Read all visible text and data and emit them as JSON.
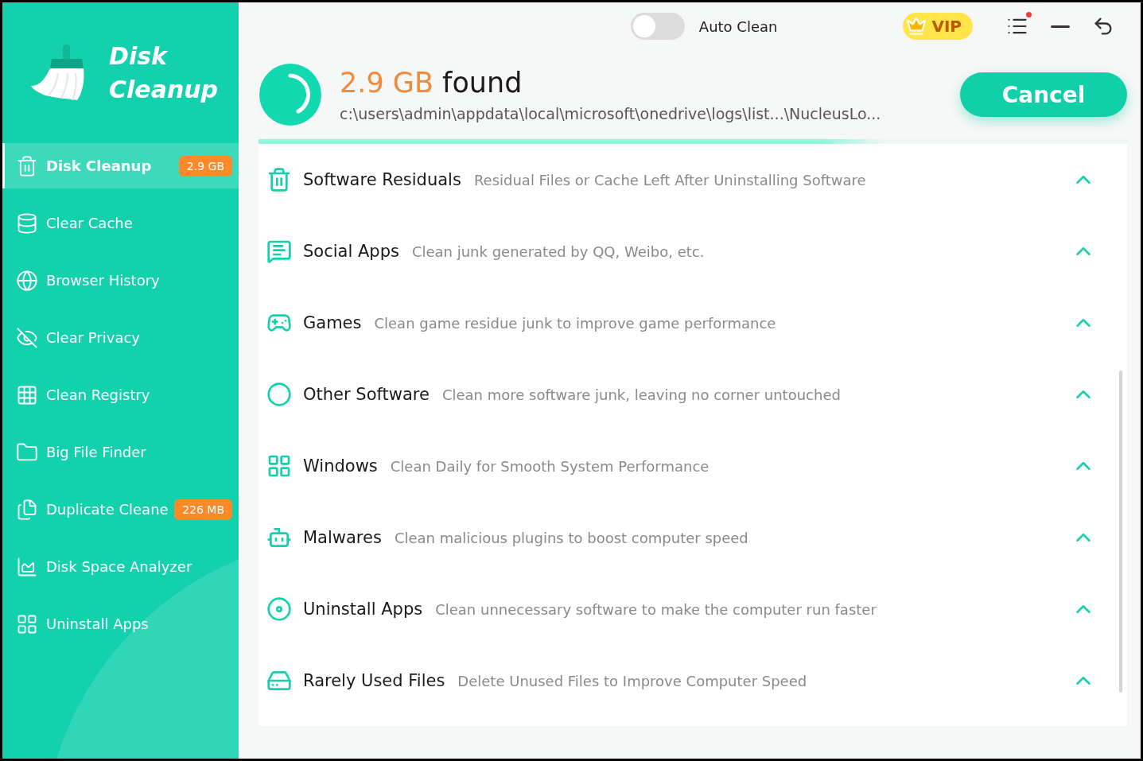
{
  "app": {
    "title_line_1": "Disk",
    "title_line_2": "Cleanup"
  },
  "top_bar": {
    "auto_clean": {
      "label": "Auto Clean",
      "on": false
    },
    "vip": "VIP",
    "notification": true
  },
  "scan": {
    "size": "2.9 GB",
    "found": "found",
    "path": "c:\\users\\admin\\appdata\\local\\microsoft\\onedrive\\logs\\list...\\NucleusLo...",
    "level": 0.72,
    "cancel": "Cancel"
  },
  "sidebar": {
    "items": [
      {
        "label": "Disk Cleanup",
        "kind": "trash",
        "badge": "2.9 GB",
        "selected": true
      },
      {
        "label": "Clear Cache",
        "kind": "cache",
        "selected": false
      },
      {
        "label": "Browser History",
        "kind": "globe",
        "selected": false
      },
      {
        "label": "Clear Privacy",
        "kind": "privacy",
        "selected": false
      },
      {
        "label": "Clean Registry",
        "kind": "registry",
        "selected": false
      },
      {
        "label": "Big File Finder",
        "kind": "folder",
        "selected": false
      },
      {
        "label": "Duplicate Cleane",
        "kind": "duplicate",
        "badge": "226 MB",
        "selected": false
      },
      {
        "label": "Disk Space Analyzer",
        "kind": "analyzer",
        "selected": false
      },
      {
        "label": "Uninstall Apps",
        "kind": "apps",
        "selected": false
      }
    ]
  },
  "categories": [
    {
      "name": "Software Residuals",
      "description": "Residual Files or Cache Left After Uninstalling Software",
      "kind": "trash",
      "expanded": true
    },
    {
      "name": "Social Apps",
      "description": "Clean junk generated by QQ, Weibo, etc.",
      "kind": "chat",
      "expanded": true
    },
    {
      "name": "Games",
      "description": "Clean game residue junk to improve game performance",
      "kind": "game",
      "expanded": true
    },
    {
      "name": "Other Software",
      "description": "Clean more software junk, leaving no corner untouched",
      "kind": "ring",
      "expanded": true
    },
    {
      "name": "Windows",
      "description": "Clean Daily for Smooth System Performance",
      "kind": "grid",
      "expanded": true
    },
    {
      "name": "Malwares",
      "description": "Clean malicious plugins to boost computer speed",
      "kind": "bot",
      "expanded": true
    },
    {
      "name": "Uninstall Apps",
      "description": "Clean unnecessary software to make the computer run faster",
      "kind": "disc",
      "expanded": true
    },
    {
      "name": "Rarely Used Files",
      "description": "Delete Unused Files to Improve Computer Speed",
      "kind": "drive",
      "expanded": true
    }
  ]
}
